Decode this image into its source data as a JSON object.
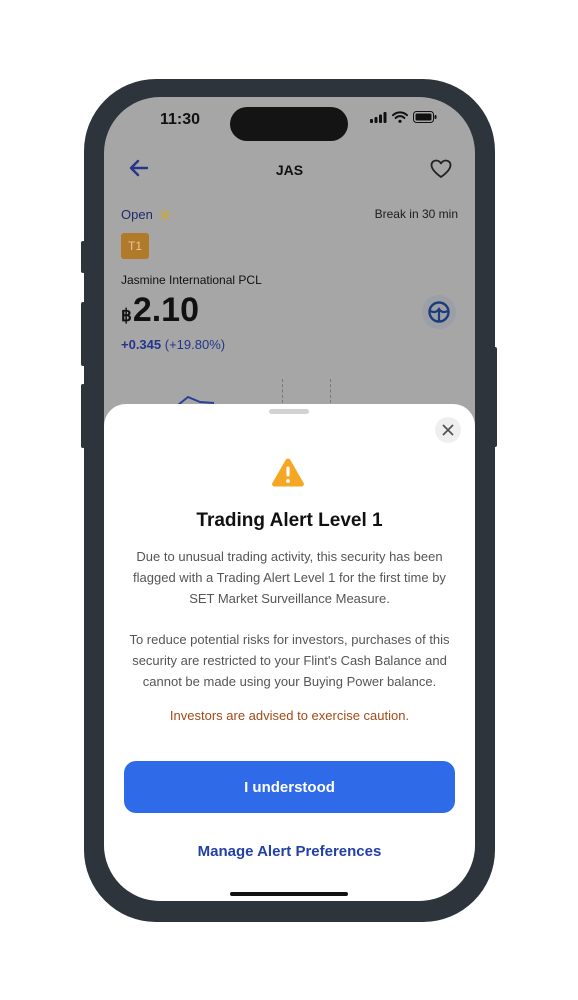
{
  "status_bar": {
    "time": "11:30"
  },
  "nav": {
    "title": "JAS"
  },
  "market": {
    "status": "Open",
    "break_info": "Break in 30 min"
  },
  "stock": {
    "tag": "T1",
    "company_name": "Jasmine International PCL",
    "currency_symbol": "฿",
    "price": "2.10",
    "change_abs": "+0.345",
    "change_pct": "(+19.80%)"
  },
  "alert": {
    "title": "Trading Alert Level 1",
    "paragraph1": "Due to unusual trading activity, this security has been flagged with a Trading Alert Level 1 for the first time by SET Market Surveillance Measure.",
    "paragraph2": "To reduce potential risks for investors, purchases of this security are restricted to your Flint's Cash Balance and cannot be made using your Buying Power balance.",
    "caution": "Investors are advised to exercise caution.",
    "primary_button": "I understood",
    "secondary_link": "Manage Alert Preferences"
  },
  "colors": {
    "primary": "#2f6ae9",
    "link": "#2340a6",
    "caution": "#a24a17",
    "warning": "#f5a623",
    "tag": "#b07a2a"
  },
  "icons": [
    "back-arrow-icon",
    "heart-icon",
    "sun-icon",
    "brand-logo-icon",
    "close-icon",
    "warning-icon",
    "signal-icon",
    "wifi-icon",
    "battery-icon"
  ]
}
